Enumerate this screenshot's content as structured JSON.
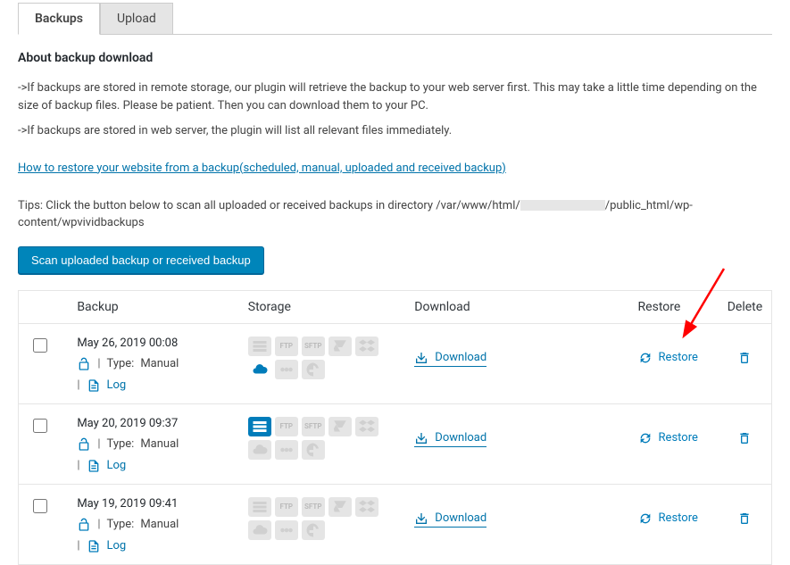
{
  "tabs": [
    {
      "label": "Backups",
      "active": true
    },
    {
      "label": "Upload",
      "active": false
    }
  ],
  "about": {
    "title": "About backup download",
    "desc1": "->If backups are stored in remote storage, our plugin will retrieve the backup to your web server first. This may take a little time depending on the size of backup files. Please be patient. Then you can download them to your PC.",
    "desc2": "->If backups are stored in web server, the plugin will list all relevant files immediately.",
    "link": "How to restore your website from a backup(scheduled, manual, uploaded and received backup)",
    "tips_prefix": "Tips: Click the button below to scan all uploaded or received backups in directory /var/www/html/",
    "tips_suffix": "/public_html/wp-content/wpvividbackups",
    "scan_button": "Scan uploaded backup or received backup"
  },
  "columns": {
    "backup": "Backup",
    "storage": "Storage",
    "download": "Download",
    "restore": "Restore",
    "delete": "Delete"
  },
  "row_labels": {
    "type_label": "Type:",
    "download": "Download",
    "restore": "Restore",
    "log": "Log"
  },
  "backups": [
    {
      "date": "May 26, 2019 00:08",
      "type": "Manual",
      "storage_active": "cloud"
    },
    {
      "date": "May 20, 2019 09:37",
      "type": "Manual",
      "storage_active": "local"
    },
    {
      "date": "May 19, 2019 09:41",
      "type": "Manual",
      "storage_active": "none"
    }
  ]
}
